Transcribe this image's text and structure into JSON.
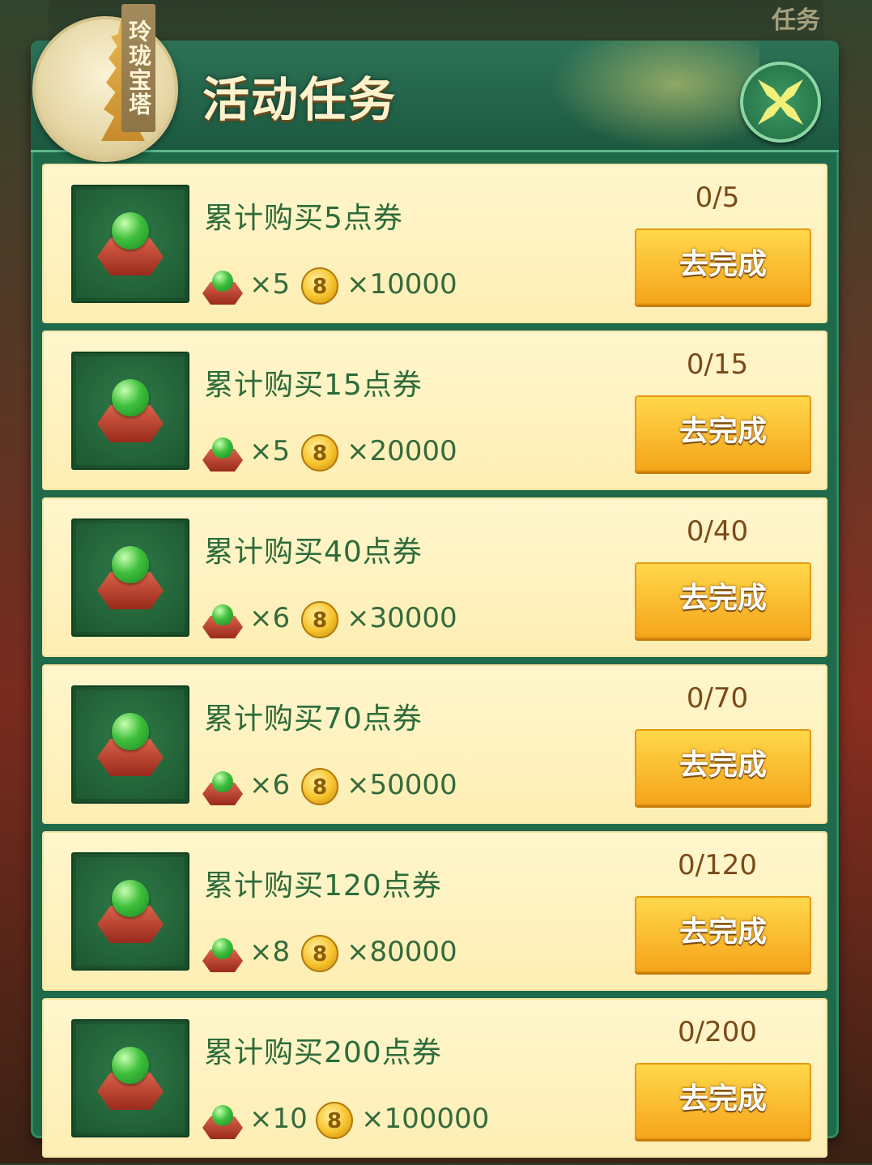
{
  "background": {
    "corner_text": "任务"
  },
  "header": {
    "badge_label": "玲珑宝塔",
    "title": "活动任务",
    "close_icon": "close-x-icon"
  },
  "tasks": [
    {
      "title": "累计购买5点券",
      "progress": "0/5",
      "gem_qty": "×5",
      "coin_label": "8",
      "coin_qty": "×10000",
      "button": "去完成"
    },
    {
      "title": "累计购买15点券",
      "progress": "0/15",
      "gem_qty": "×5",
      "coin_label": "8",
      "coin_qty": "×20000",
      "button": "去完成"
    },
    {
      "title": "累计购买40点券",
      "progress": "0/40",
      "gem_qty": "×6",
      "coin_label": "8",
      "coin_qty": "×30000",
      "button": "去完成"
    },
    {
      "title": "累计购买70点券",
      "progress": "0/70",
      "gem_qty": "×6",
      "coin_label": "8",
      "coin_qty": "×50000",
      "button": "去完成"
    },
    {
      "title": "累计购买120点券",
      "progress": "0/120",
      "gem_qty": "×8",
      "coin_label": "8",
      "coin_qty": "×80000",
      "button": "去完成"
    },
    {
      "title": "累计购买200点券",
      "progress": "0/200",
      "gem_qty": "×10",
      "coin_label": "8",
      "coin_qty": "×100000",
      "button": "去完成"
    }
  ],
  "colors": {
    "panel": "#1f6a4a",
    "row_bg": "#fff6cd",
    "button": "#f6a51c",
    "title_text": "#2d6b3a"
  }
}
